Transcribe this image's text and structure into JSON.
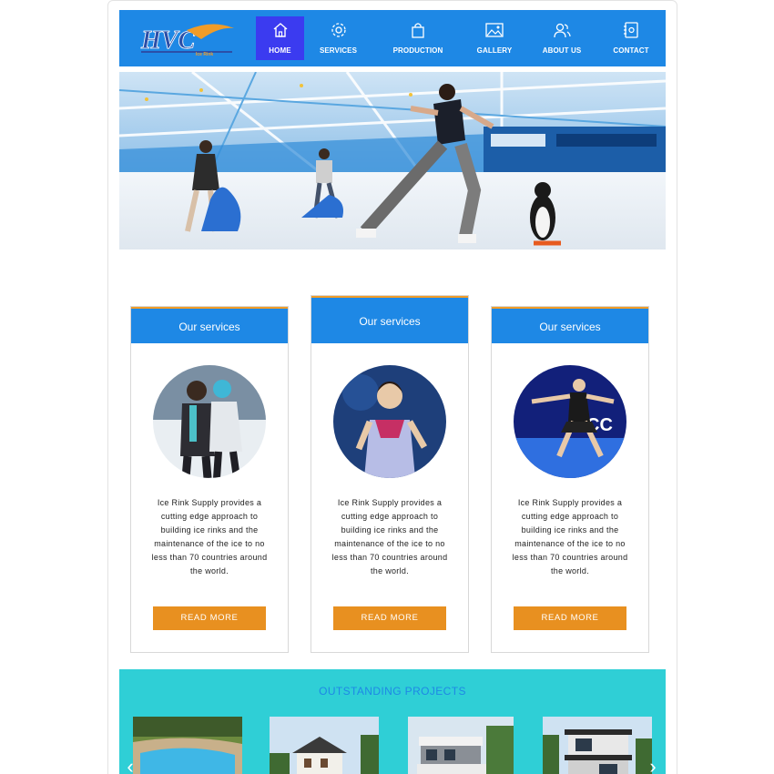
{
  "brand": {
    "logo_text": "HVC",
    "logo_sub": "Ice Rink"
  },
  "nav": {
    "items": [
      {
        "label": "HOME",
        "icon": "home-icon",
        "active": true
      },
      {
        "label": "SERVICES",
        "icon": "gear-icon",
        "active": false
      },
      {
        "label": "PRODUCTION",
        "icon": "shopping-bag-icon",
        "active": false
      },
      {
        "label": "GALLERY",
        "icon": "image-icon",
        "active": false
      },
      {
        "label": "ABOUT US",
        "icon": "users-icon",
        "active": false
      },
      {
        "label": "CONTACT",
        "icon": "phone-book-icon",
        "active": false
      }
    ]
  },
  "hero": {
    "image": "ice-rink-skaters-photo"
  },
  "services": {
    "cards": [
      {
        "title": "Our services",
        "text": "Ice Rink Supply provides a cutting edge approach to building ice rinks and the maintenance of the ice to no less than 70 countries around the world.",
        "button": "READ MORE",
        "image": "couple-skating-photo"
      },
      {
        "title": "Our services",
        "text": "Ice Rink Supply provides a cutting edge approach to building ice rinks and the maintenance of the ice to no less than 70 countries around the world.",
        "button": "READ MORE",
        "image": "figure-skater-portrait-photo"
      },
      {
        "title": "Our services",
        "text": "Ice Rink Supply provides a cutting edge approach to building ice rinks and the maintenance of the ice to no less than 70 countries around the world.",
        "button": "READ MORE",
        "image": "figure-skater-performing-photo"
      }
    ]
  },
  "projects": {
    "title": "OUTSTANDING PROJECTS",
    "items": [
      "pool-resort-photo",
      "villa-house-photo",
      "modern-house-photo",
      "modern-villa-photo"
    ]
  },
  "colors": {
    "primary": "#1e88e5",
    "accent": "#e89020",
    "teal": "#2fcfd6",
    "active_nav": "#3b3bf0"
  }
}
